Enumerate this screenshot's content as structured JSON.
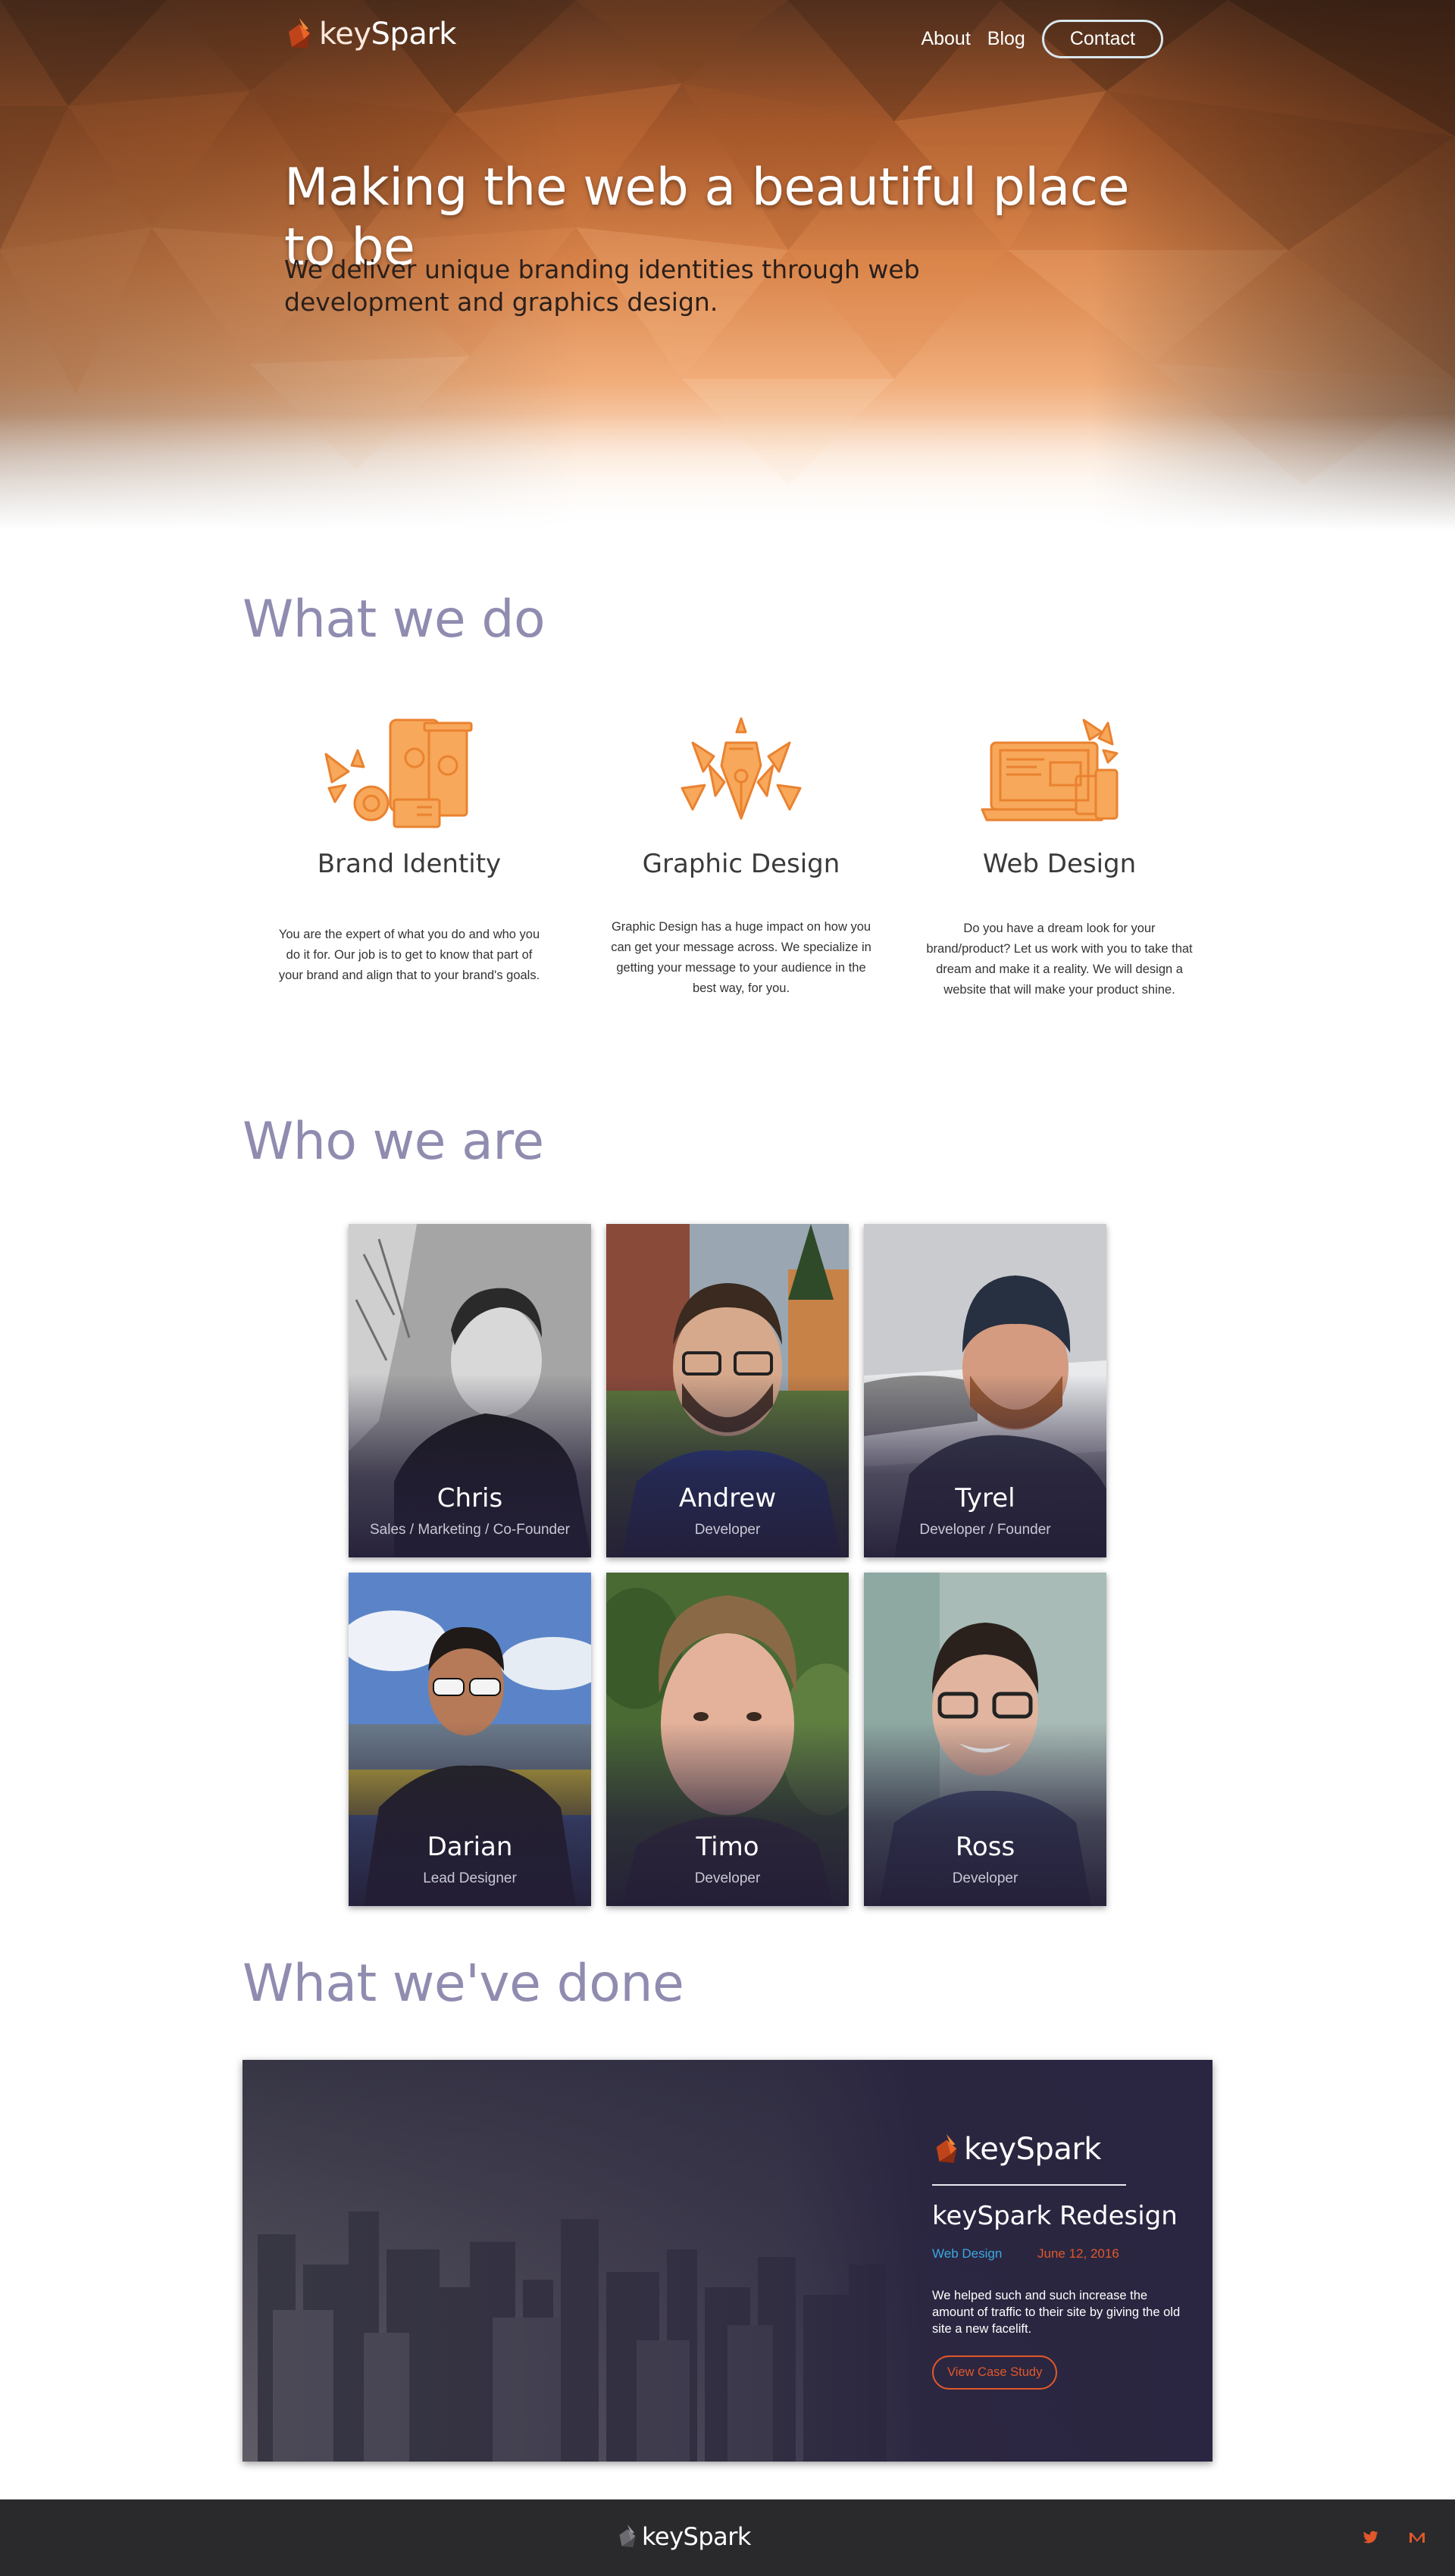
{
  "brand": {
    "logo_prefix": "key",
    "logo_suffix": "Spark",
    "accent": "#e0582a"
  },
  "nav": {
    "links": [
      "About",
      "Blog"
    ],
    "contact_label": "Contact"
  },
  "hero": {
    "title": "Making the web a beautiful place to be",
    "subtitle": "We deliver unique branding identities through web development and graphics design."
  },
  "services": {
    "heading": "What we do",
    "items": [
      {
        "name": "Brand Identity",
        "icon": "brand-identity-icon",
        "description": "You are the expert of what you do and who you do it for. Our job is to get to know that part of your brand and align that to your brand's goals."
      },
      {
        "name": "Graphic Design",
        "icon": "pen-nib-icon",
        "description": "Graphic Design has a huge impact on how you can get your message across. We specialize in getting your message to your audience in the best way, for you."
      },
      {
        "name": "Web Design",
        "icon": "laptop-devices-icon",
        "description": "Do you have a dream look for your brand/product? Let us work with you to take that dream and make it a reality. We will design a website that will make your product shine."
      }
    ]
  },
  "team": {
    "heading": "Who we are",
    "members": [
      {
        "name": "Chris",
        "role": "Sales / Marketing / Co-Founder"
      },
      {
        "name": "Andrew",
        "role": "Developer"
      },
      {
        "name": "Tyrel",
        "role": "Developer / Founder"
      },
      {
        "name": "Darian",
        "role": "Lead Designer"
      },
      {
        "name": "Timo",
        "role": "Developer"
      },
      {
        "name": "Ross",
        "role": "Developer"
      }
    ]
  },
  "work": {
    "heading": "What we've done",
    "project": {
      "logo_prefix": "key",
      "logo_suffix": "Spark",
      "title": "keySpark Redesign",
      "category": "Web Design",
      "date": "June 12, 2016",
      "description": "We helped such and such increase the amount of traffic to their site by giving the old site a new facelift.",
      "button_label": "View Case Study"
    }
  },
  "footer": {
    "logo_prefix": "key",
    "logo_suffix": "Spark",
    "social": [
      "twitter-icon",
      "medium-icon"
    ]
  }
}
